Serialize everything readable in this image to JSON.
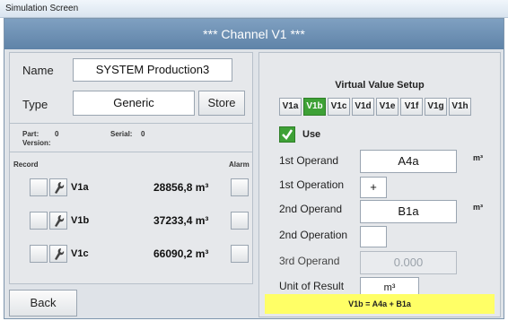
{
  "window_title": "Simulation Screen",
  "header_title": "*** Channel V1 ***",
  "left": {
    "name_label": "Name",
    "name_value": "SYSTEM Production3",
    "type_label": "Type",
    "type_value": "Generic",
    "store_label": "Store",
    "part_label": "Part:",
    "part_value": "0",
    "serial_label": "Serial:",
    "serial_value": "0",
    "version_label": "Version:",
    "record_label": "Record",
    "alarm_label": "Alarm",
    "rows": [
      {
        "name": "V1a",
        "value": "28856,8 m³"
      },
      {
        "name": "V1b",
        "value": "37233,4 m³"
      },
      {
        "name": "V1c",
        "value": "66090,2 m³"
      }
    ],
    "back_label": "Back"
  },
  "right": {
    "title": "Virtual Value Setup",
    "tabs": [
      "V1a",
      "V1b",
      "V1c",
      "V1d",
      "V1e",
      "V1f",
      "V1g",
      "V1h"
    ],
    "active_tab": "V1b",
    "use_label": "Use",
    "use_checked": true,
    "first_operand_label": "1st Operand",
    "first_operand_value": "A4a",
    "first_operand_unit": "m³",
    "first_operation_label": "1st Operation",
    "first_operation_value": "+",
    "second_operand_label": "2nd Operand",
    "second_operand_value": "B1a",
    "second_operand_unit": "m³",
    "second_operation_label": "2nd Operation",
    "second_operation_value": "",
    "third_operand_label": "3rd Operand",
    "third_operand_value": "0.000",
    "unit_result_label": "Unit of Result",
    "unit_result_value": "m³",
    "formula": "V1b = A4a + B1a"
  },
  "colors": {
    "header": "#6f92b5",
    "active_tab": "#3ea136",
    "formula_bg": "#ffff66"
  }
}
